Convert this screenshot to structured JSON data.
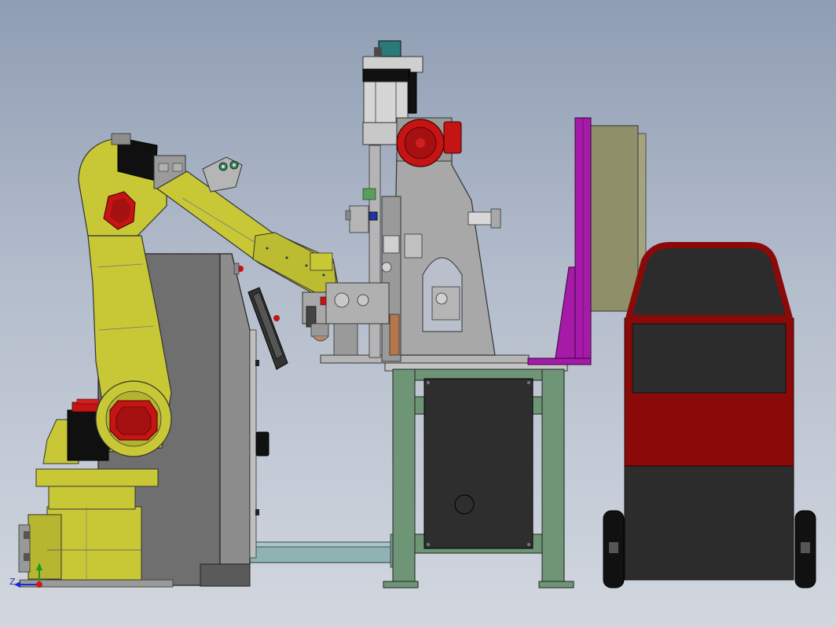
{
  "viewport": {
    "background_top": "#8f9db3",
    "background_bottom": "#d2d7df"
  },
  "colors": {
    "robot_yellow": "#c8c837",
    "robot_yellow_dark": "#9a9a22",
    "motor_red": "#c41414",
    "motor_black": "#101010",
    "cabinet_gray": "#6f6f6f",
    "table_green": "#6e9575",
    "fixture_gray": "#a8a8a8",
    "panel_magenta": "#a51ba8",
    "panel_olive": "#8f8f6a",
    "cart_red": "#8a0a0a",
    "cart_dark": "#2c2c2c",
    "rail_teal": "#8fb3b5"
  },
  "components": [
    {
      "name": "industrial-robot-arm",
      "icon": "robot-arm-icon"
    },
    {
      "name": "robot-control-cabinet",
      "icon": "cabinet-icon"
    },
    {
      "name": "welding-fixture-station",
      "icon": "fixture-icon"
    },
    {
      "name": "work-table",
      "icon": "table-icon"
    },
    {
      "name": "magenta-safety-panel",
      "icon": "panel-icon"
    },
    {
      "name": "mobile-cart",
      "icon": "cart-icon"
    },
    {
      "name": "floor-rail",
      "icon": "rail-icon"
    }
  ],
  "axis_triad": {
    "label": "Z",
    "x_color": "#d11818",
    "y_color": "#1a9a1a",
    "z_color": "#1a2ad1"
  }
}
